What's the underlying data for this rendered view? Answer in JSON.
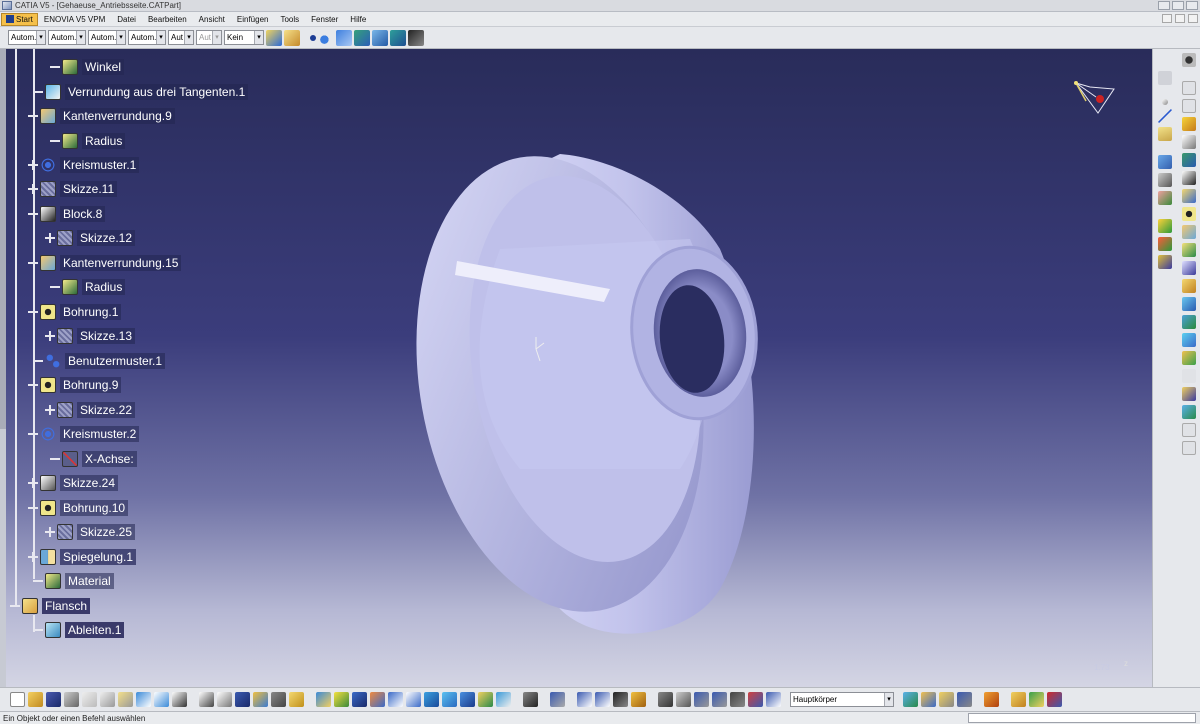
{
  "window": {
    "title": "CATIA V5 - [Gehaeuse_Antriebsseite.CATPart]"
  },
  "menu": {
    "items": [
      "Start",
      "ENOVIA V5 VPM",
      "Datei",
      "Bearbeiten",
      "Ansicht",
      "Einfügen",
      "Tools",
      "Fenster",
      "Hilfe"
    ]
  },
  "toolbar_top": {
    "combos": [
      "Autom.",
      "Autom.",
      "Autom.",
      "Autom.",
      "Aut",
      "Aut",
      "Kein"
    ]
  },
  "tree": {
    "nodes": [
      {
        "label": "Winkel",
        "icon": "parameter-icon"
      },
      {
        "label": "Verrundung aus drei Tangenten.1",
        "icon": "tritangent-fillet-icon"
      },
      {
        "label": "Kantenverrundung.9",
        "icon": "edge-fillet-icon"
      },
      {
        "label": "Radius",
        "icon": "parameter-icon"
      },
      {
        "label": "Kreismuster.1",
        "icon": "circular-pattern-icon"
      },
      {
        "label": "Skizze.11",
        "icon": "sketch-icon"
      },
      {
        "label": "Block.8",
        "icon": "pad-icon"
      },
      {
        "label": "Skizze.12",
        "icon": "sketch-icon"
      },
      {
        "label": "Kantenverrundung.15",
        "icon": "edge-fillet-icon"
      },
      {
        "label": "Radius",
        "icon": "parameter-icon"
      },
      {
        "label": "Bohrung.1",
        "icon": "hole-icon"
      },
      {
        "label": "Skizze.13",
        "icon": "sketch-icon"
      },
      {
        "label": "Benutzermuster.1",
        "icon": "user-pattern-icon"
      },
      {
        "label": "Bohrung.9",
        "icon": "hole-icon"
      },
      {
        "label": "Skizze.22",
        "icon": "sketch-icon"
      },
      {
        "label": "Kreismuster.2",
        "icon": "circular-pattern-icon"
      },
      {
        "label": "X-Achse:",
        "icon": "axis-icon"
      },
      {
        "label": "Skizze.24",
        "icon": "sketch-icon"
      },
      {
        "label": "Bohrung.10",
        "icon": "hole-icon"
      },
      {
        "label": "Skizze.25",
        "icon": "sketch-icon"
      },
      {
        "label": "Spiegelung.1",
        "icon": "mirror-icon"
      },
      {
        "label": "Material",
        "icon": "material-icon"
      },
      {
        "label": "Flansch",
        "icon": "body-icon"
      },
      {
        "label": "Ableiten.1",
        "icon": "derive-icon"
      }
    ]
  },
  "viewport": {
    "zoom": "1.73",
    "axis_label": "z"
  },
  "toolbar_bottom": {
    "body_select": "Hauptkörper"
  },
  "status": {
    "text": "Ein Objekt oder einen Befehl auswählen"
  },
  "colors": {
    "part_face": "#c7c8f0",
    "part_shadow": "#8a8cc7",
    "background_top": "#292c5a",
    "background_bottom": "#d4d5e4",
    "tree_text": "#ffffff"
  }
}
